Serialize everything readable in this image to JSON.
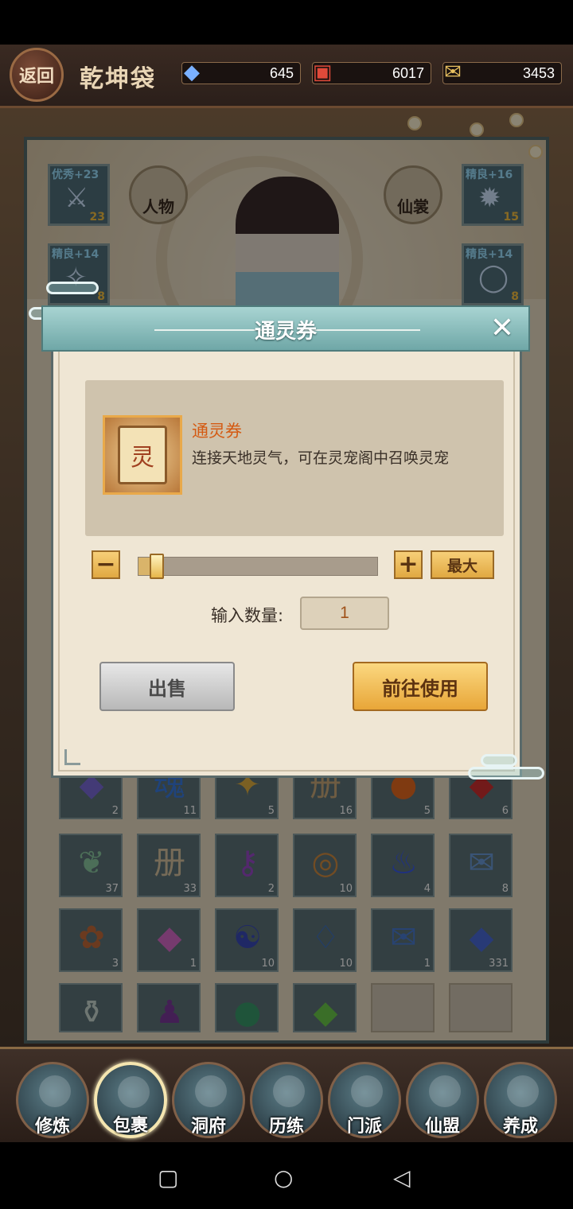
{
  "header": {
    "back_label": "返回",
    "title": "乾坤袋",
    "currencies": [
      {
        "icon": "crystal-icon",
        "value": "645"
      },
      {
        "icon": "gift-pack-icon",
        "value": "6017"
      },
      {
        "icon": "scroll-icon",
        "value": "3453"
      }
    ]
  },
  "equipment": {
    "left_top": {
      "tag": "优秀+23",
      "count": "23",
      "icon": "sword-icon"
    },
    "left_mid": {
      "tag": "精良+14",
      "count": "8",
      "icon": "accessory-icon"
    },
    "right_top": {
      "tag": "精良+16",
      "count": "15",
      "icon": "amulet-icon"
    },
    "right_mid": {
      "tag": "精良+14",
      "count": "8",
      "icon": "ring-icon"
    },
    "btn_character": "人物",
    "btn_costume": "仙裳"
  },
  "dialog": {
    "title": "通灵券",
    "item_name": "通灵券",
    "item_icon_char": "灵",
    "item_desc": "连接天地灵气，可在灵宠阁中召唤灵宠",
    "minus": "−",
    "plus": "+",
    "max_label": "最大",
    "slider_value": 0.03,
    "qty_label": "输入数量:",
    "qty_value": "1",
    "sell_label": "出售",
    "use_label": "前往使用",
    "close": "✕"
  },
  "inventory": {
    "row1": [
      {
        "icon": "crystal-cluster-icon",
        "glyph": "◆",
        "color": "#7a6ad8",
        "count": "2"
      },
      {
        "icon": "soul-orb-icon",
        "glyph": "魂",
        "color": "#3a7ae0",
        "count": "11"
      },
      {
        "icon": "feather-gold-icon",
        "glyph": "✦",
        "color": "#e0b040",
        "count": "5"
      },
      {
        "icon": "book-icon",
        "glyph": "册",
        "color": "#c9a878",
        "count": "16"
      },
      {
        "icon": "fire-orb-icon",
        "glyph": "●",
        "color": "#e86a20",
        "count": "5"
      },
      {
        "icon": "red-gem-icon",
        "glyph": "◆",
        "color": "#d03030",
        "count": "6"
      }
    ],
    "row2": [
      {
        "icon": "green-feather-icon",
        "glyph": "❦",
        "color": "#8ac8a0",
        "count": "37"
      },
      {
        "icon": "manual-icon",
        "glyph": "册",
        "color": "#d8c4a0",
        "count": "33"
      },
      {
        "icon": "purple-key-icon",
        "glyph": "⚷",
        "color": "#9a4ac8",
        "count": "2"
      },
      {
        "icon": "bronze-coin-icon",
        "glyph": "◎",
        "color": "#d08a40",
        "count": "10"
      },
      {
        "icon": "blue-flame-icon",
        "glyph": "♨",
        "color": "#3a5ae8",
        "count": "4"
      },
      {
        "icon": "blue-scroll-icon",
        "glyph": "✉",
        "color": "#6a9ad8",
        "count": "8"
      }
    ],
    "row3": [
      {
        "icon": "seed-sack-icon",
        "glyph": "✿",
        "color": "#c46a3a",
        "count": "3"
      },
      {
        "icon": "rainbow-crystal-icon",
        "glyph": "◆",
        "color": "#d86ac8",
        "count": "1"
      },
      {
        "icon": "taiji-orb-icon",
        "glyph": "☯",
        "color": "#3a4ab8",
        "count": "10"
      },
      {
        "icon": "blue-pouch-icon",
        "glyph": "♢",
        "color": "#3a70c8",
        "count": "10"
      },
      {
        "icon": "edict-scroll-icon",
        "glyph": "✉",
        "color": "#4a7ad0",
        "count": "1"
      },
      {
        "icon": "blue-crystal-icon",
        "glyph": "◆",
        "color": "#4a6ad8",
        "count": "331"
      }
    ],
    "row4": [
      {
        "icon": "bottle-icon",
        "glyph": "⚱",
        "color": "#c8d8d0",
        "count": ""
      },
      {
        "icon": "purple-bag-icon",
        "glyph": "♟",
        "color": "#7a3a9a",
        "count": ""
      },
      {
        "icon": "jade-orb-icon",
        "glyph": "●",
        "color": "#3a9a6a",
        "count": ""
      },
      {
        "icon": "green-shard-icon",
        "glyph": "◆",
        "color": "#6ac84a",
        "count": ""
      }
    ]
  },
  "nav": [
    {
      "label": "修炼",
      "icon": "cultivate-icon"
    },
    {
      "label": "包裹",
      "icon": "bag-icon"
    },
    {
      "label": "洞府",
      "icon": "cave-icon"
    },
    {
      "label": "历练",
      "icon": "training-icon"
    },
    {
      "label": "门派",
      "icon": "sect-icon"
    },
    {
      "label": "仙盟",
      "icon": "alliance-icon"
    },
    {
      "label": "养成",
      "icon": "nurture-icon"
    }
  ],
  "system_nav": {
    "recent": "▢",
    "home": "○",
    "back": "◁"
  }
}
